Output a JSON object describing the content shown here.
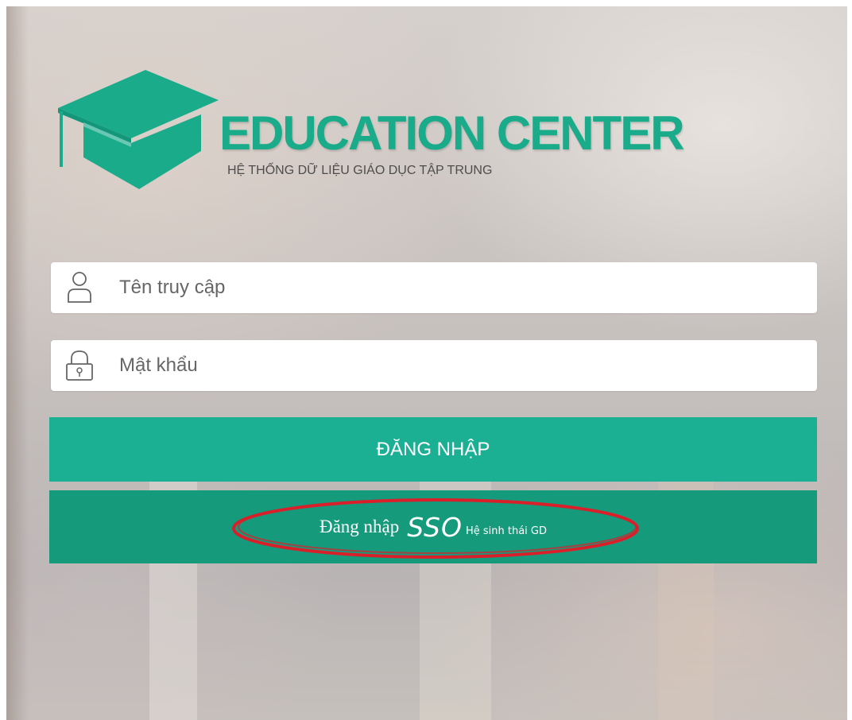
{
  "brand": {
    "title": "EDUCATION CENTER",
    "subtitle": "HỆ THỐNG DỮ LIỆU GIÁO DỤC TẬP TRUNG",
    "logo_icon": "graduation-cap-icon",
    "accent": "#1aab8a"
  },
  "form": {
    "username": {
      "placeholder": "Tên truy cập",
      "value": "",
      "icon": "user-icon"
    },
    "password": {
      "placeholder": "Mật khẩu",
      "value": "",
      "icon": "lock-icon"
    },
    "login_label": "ĐĂNG NHẬP",
    "login_color": "#1bb093",
    "sso": {
      "prefix": "Đăng nhập",
      "brand": "SSO",
      "suffix": "Hệ sinh thái GD",
      "color": "#159a7c",
      "highlight_color": "#d9202a"
    }
  }
}
